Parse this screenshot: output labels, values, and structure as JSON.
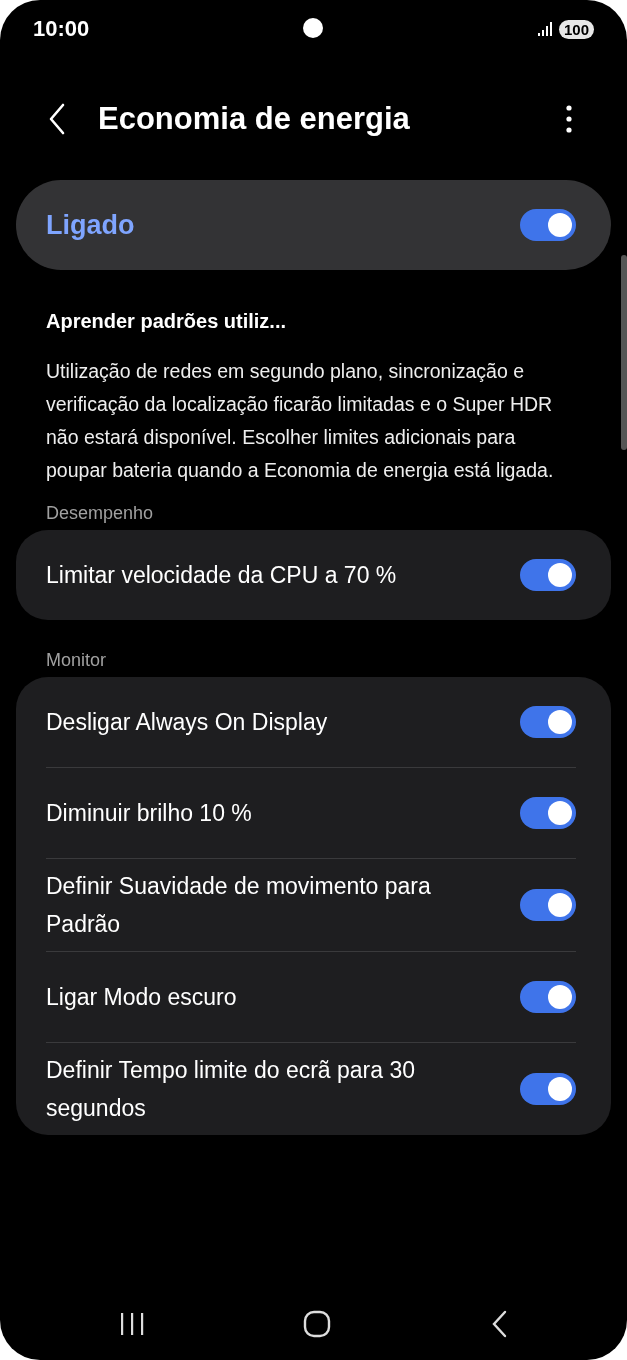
{
  "status_bar": {
    "time": "10:00",
    "battery": "100"
  },
  "header": {
    "title": "Economia de energia"
  },
  "master": {
    "label": "Ligado",
    "on": true
  },
  "subtitle": "Aprender padrões utiliz...",
  "description": "Utilização de redes em segundo plano, sincronização e verificação da localização ficarão limitadas e o Super HDR não estará disponível. Escolher limites adicionais para poupar bateria quando a Economia de energia está ligada.",
  "sections": [
    {
      "title": "Desempenho",
      "items": [
        {
          "label": "Limitar velocidade da CPU a 70 %",
          "on": true
        }
      ]
    },
    {
      "title": "Monitor",
      "items": [
        {
          "label": "Desligar Always On Display",
          "on": true
        },
        {
          "label": "Diminuir brilho 10 %",
          "on": true
        },
        {
          "label": "Definir Suavidade de movimento para Padrão",
          "on": true
        },
        {
          "label": "Ligar Modo escuro",
          "on": true
        },
        {
          "label": "Definir Tempo limite do ecrã para 30 segundos",
          "on": true
        }
      ]
    }
  ]
}
